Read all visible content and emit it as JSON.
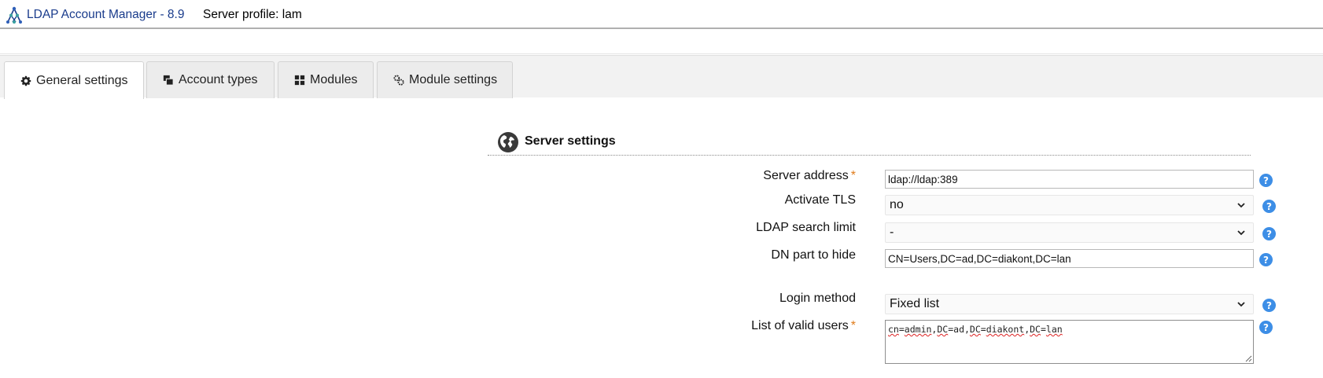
{
  "header": {
    "app_title": "LDAP Account Manager - 8.9",
    "server_profile": "Server profile: lam"
  },
  "tabs": [
    {
      "label": "General settings",
      "icon": "gear-icon",
      "active": true
    },
    {
      "label": "Account types",
      "icon": "account-types-icon",
      "active": false
    },
    {
      "label": "Modules",
      "icon": "grid-icon",
      "active": false
    },
    {
      "label": "Module settings",
      "icon": "gears-icon",
      "active": false
    }
  ],
  "section": {
    "title": "Server settings",
    "icon": "globe-icon"
  },
  "form": {
    "server_address": {
      "label": "Server address",
      "value": "ldap://ldap:389",
      "required": true
    },
    "activate_tls": {
      "label": "Activate TLS",
      "value": "no"
    },
    "search_limit": {
      "label": "LDAP search limit",
      "value": "-"
    },
    "dn_hide": {
      "label": "DN part to hide",
      "value": "CN=Users,DC=ad,DC=diakont,DC=lan"
    },
    "login_method": {
      "label": "Login method",
      "value": "Fixed list"
    },
    "valid_users": {
      "label": "List of valid users",
      "required": true,
      "parts": [
        "cn",
        "=",
        "admin",
        ",",
        "DC",
        "=ad,",
        "DC",
        "=",
        "diakont",
        ",",
        "DC",
        "=",
        "lan"
      ]
    },
    "help_glyph": "?",
    "required_mark": "*"
  },
  "colors": {
    "title_blue": "#1a3c8c",
    "required_orange": "#e07b1a",
    "help_blue": "#3d8ee6"
  }
}
